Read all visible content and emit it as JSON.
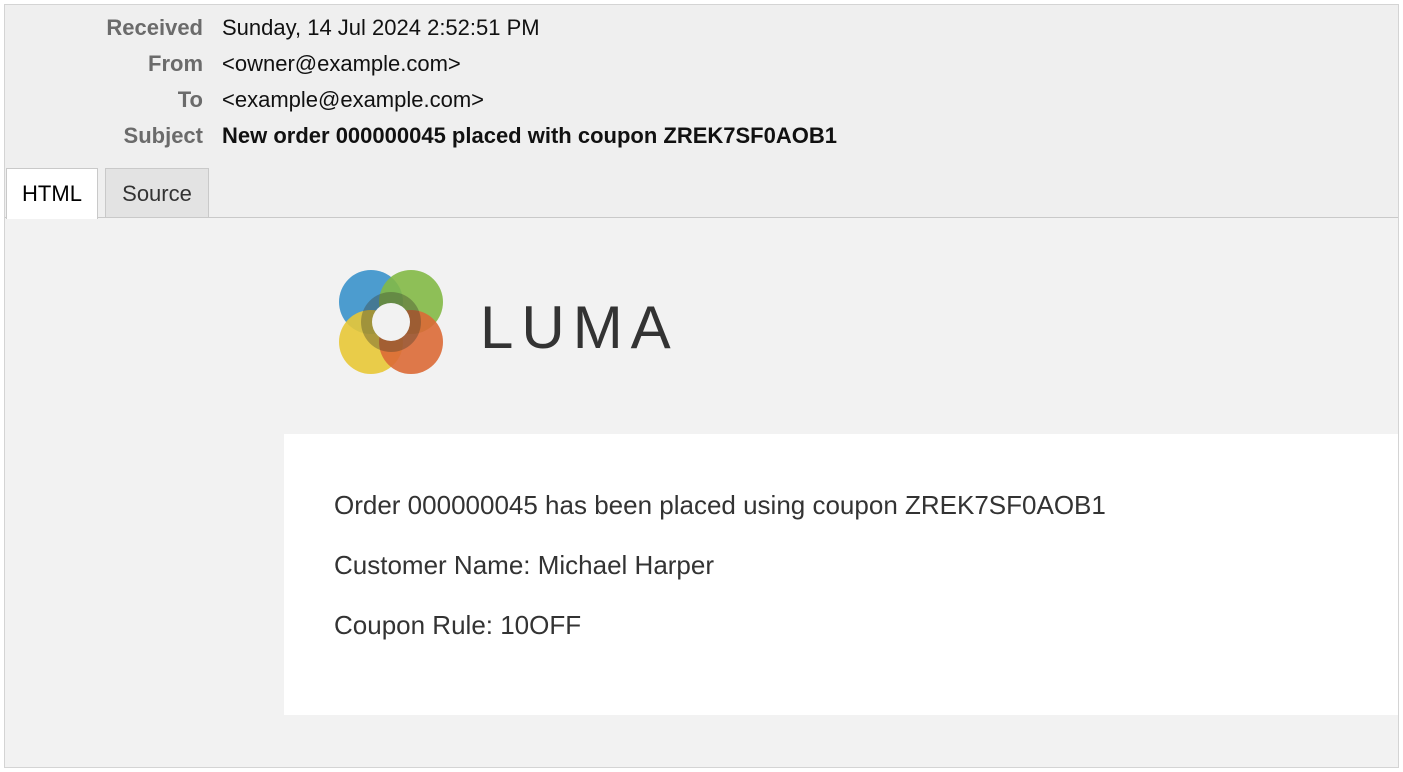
{
  "headers": {
    "received": {
      "label": "Received",
      "value": "Sunday, 14 Jul 2024 2:52:51 PM"
    },
    "from": {
      "label": "From",
      "value": "<owner@example.com>"
    },
    "to": {
      "label": "To",
      "value": "<example@example.com>"
    },
    "subject": {
      "label": "Subject",
      "value": "New order 000000045 placed with coupon ZREK7SF0AOB1"
    }
  },
  "tabs": [
    {
      "label": "HTML",
      "active": true
    },
    {
      "label": "Source",
      "active": false
    }
  ],
  "logo": {
    "text": "LUMA",
    "icon": "luma-logo-icon",
    "colors": {
      "blue": "#3d9ad6",
      "green": "#8bc34a",
      "yellow": "#f5d33a",
      "orange": "#e8703a",
      "text": "#333333"
    }
  },
  "message": {
    "line1": "Order 000000045 has been placed using coupon ZREK7SF0AOB1",
    "line2": "Customer Name: Michael Harper",
    "line3": "Coupon Rule: 10OFF"
  }
}
